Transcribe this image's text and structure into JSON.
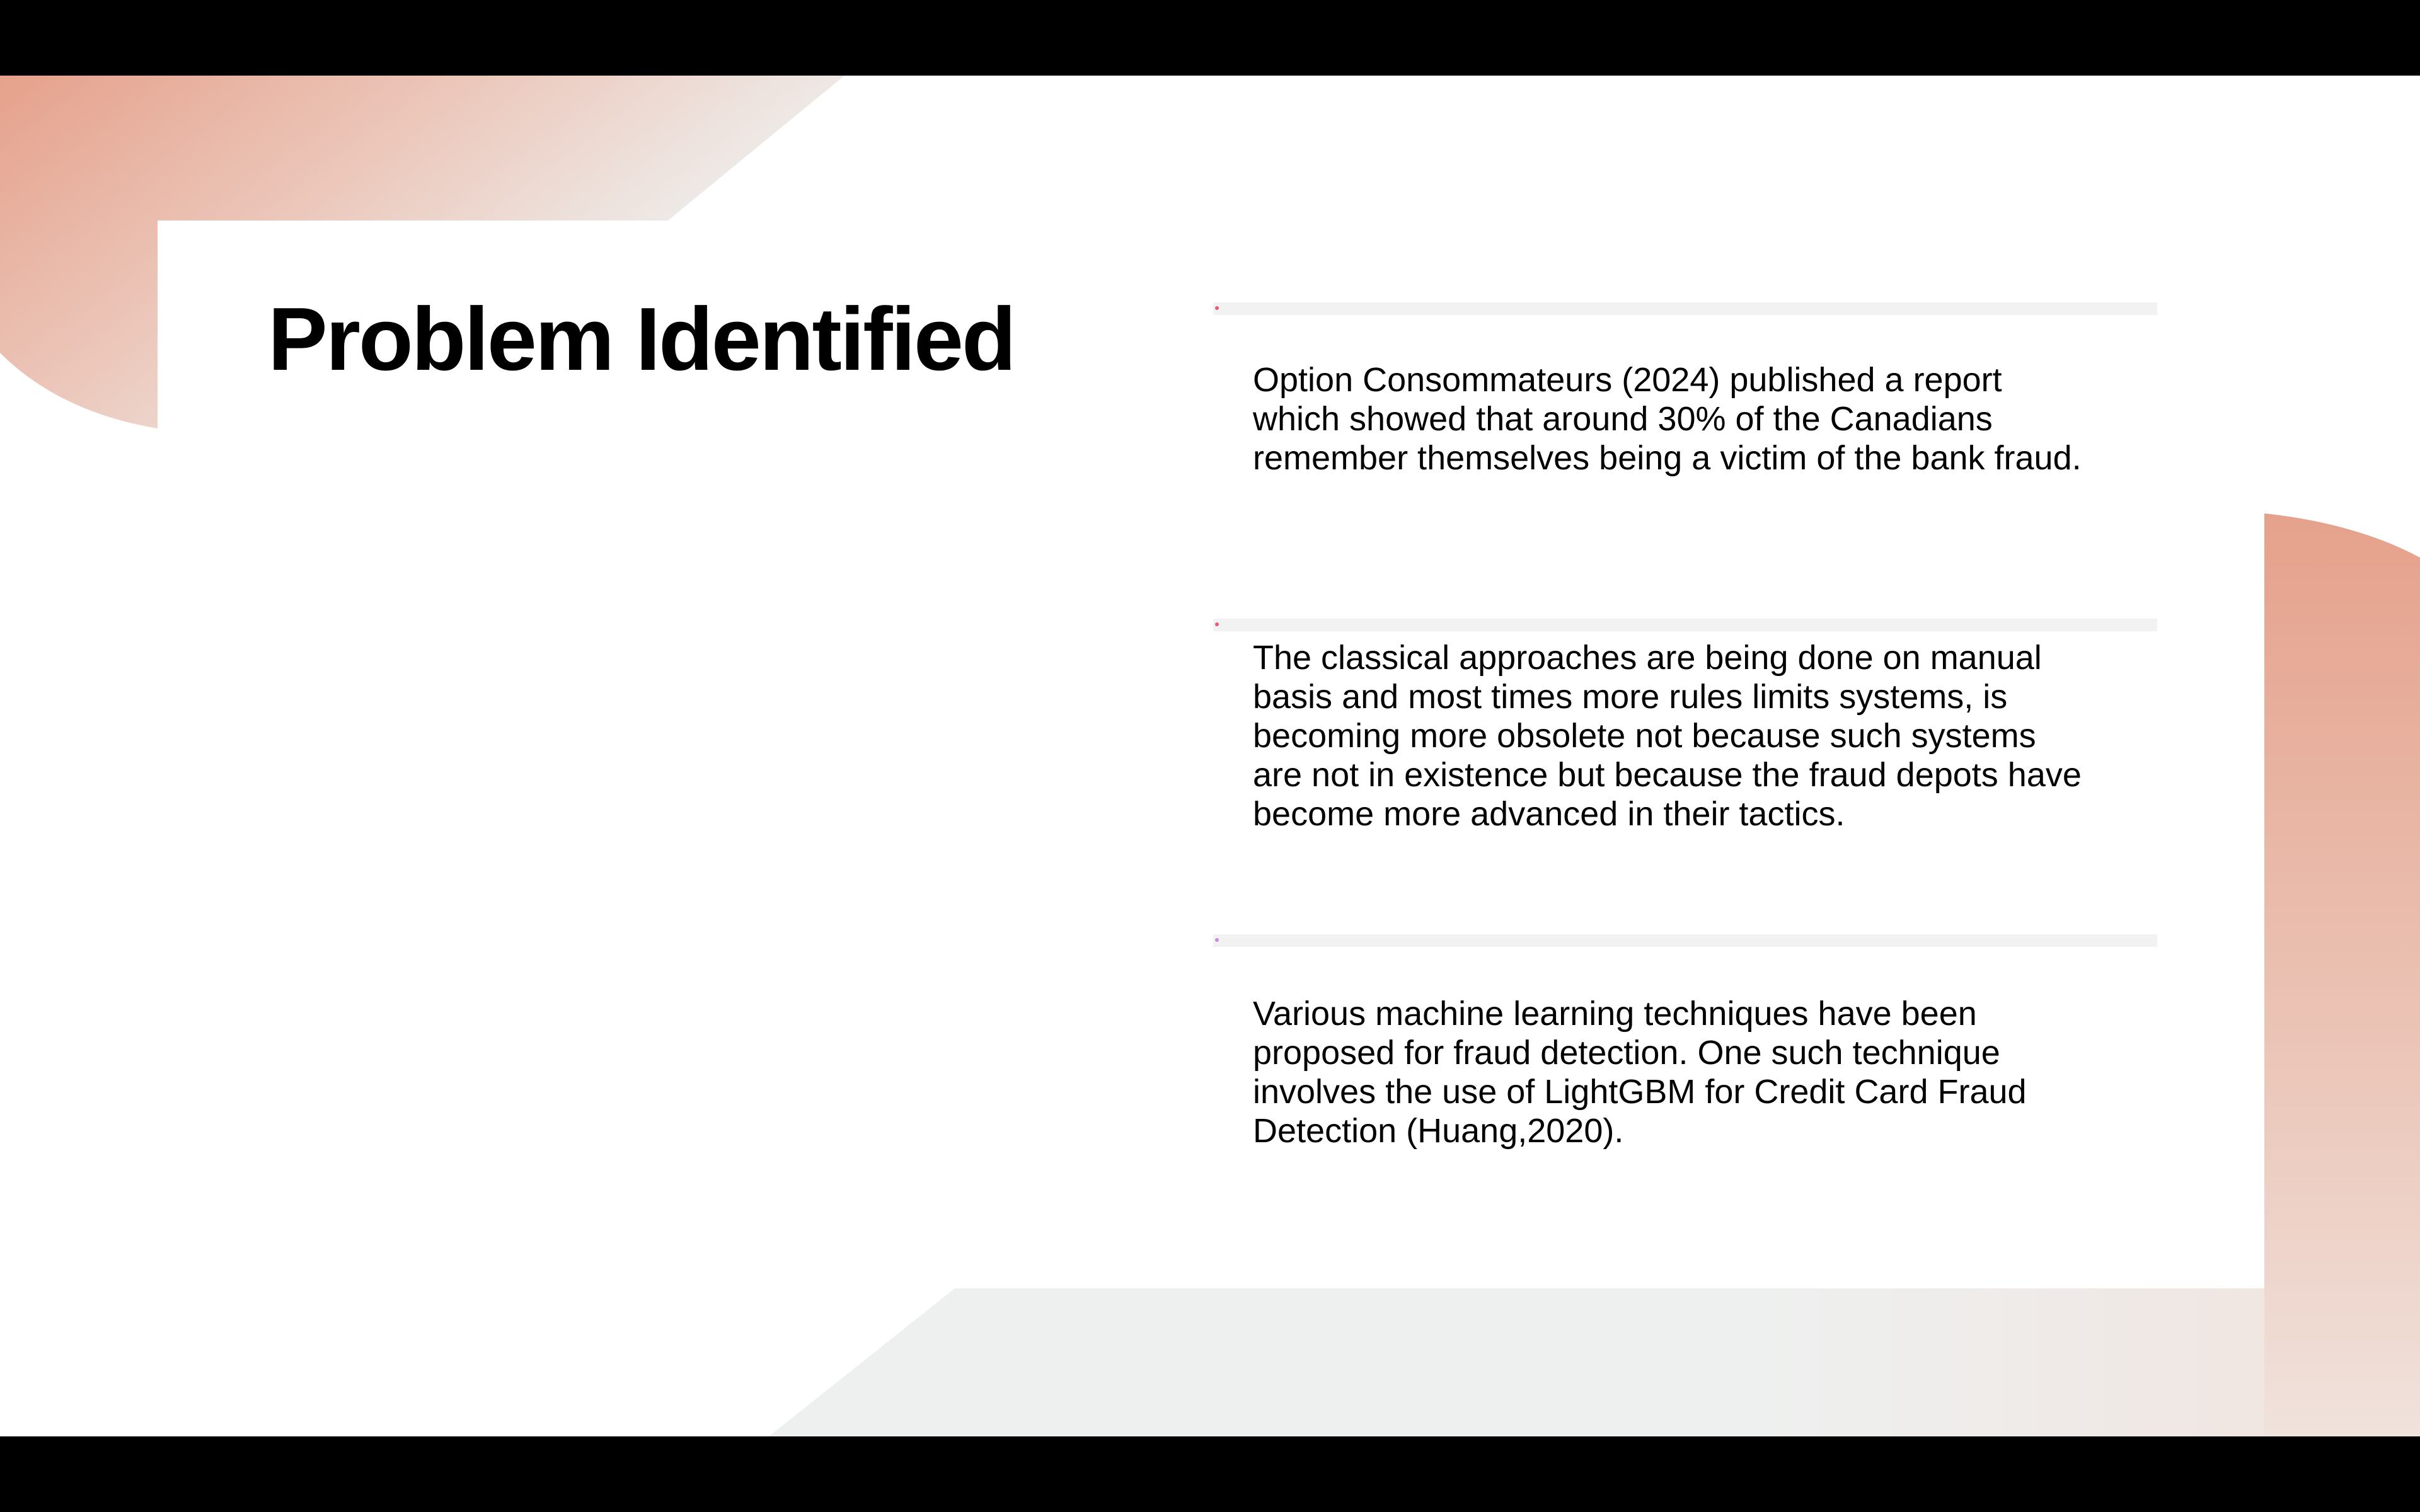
{
  "slide": {
    "title": "Problem Identified",
    "points": [
      {
        "text": "Option Consommateurs (2024) published a report which showed that around 30% of the Canadians remember themselves being a victim of the bank fraud.",
        "marker_color": "#e85a6f"
      },
      {
        "text": "The classical approaches are being done on manual basis and most times more rules limits systems, is becoming more obsolete not because such systems are not in existence but because the fraud depots have become more advanced in their tactics.",
        "marker_color": "#e85a6f"
      },
      {
        "text": "Various machine learning techniques have been proposed for fraud detection. One such technique involves the use of LightGBM for Credit Card Fraud Detection (Huang,2020).",
        "marker_color": "#c98be0"
      }
    ]
  },
  "colors": {
    "accent_peach": "#e5a18b",
    "pale_gray": "#eef0ef",
    "letterbox": "#000000",
    "bar_track": "#f2f2f3"
  }
}
